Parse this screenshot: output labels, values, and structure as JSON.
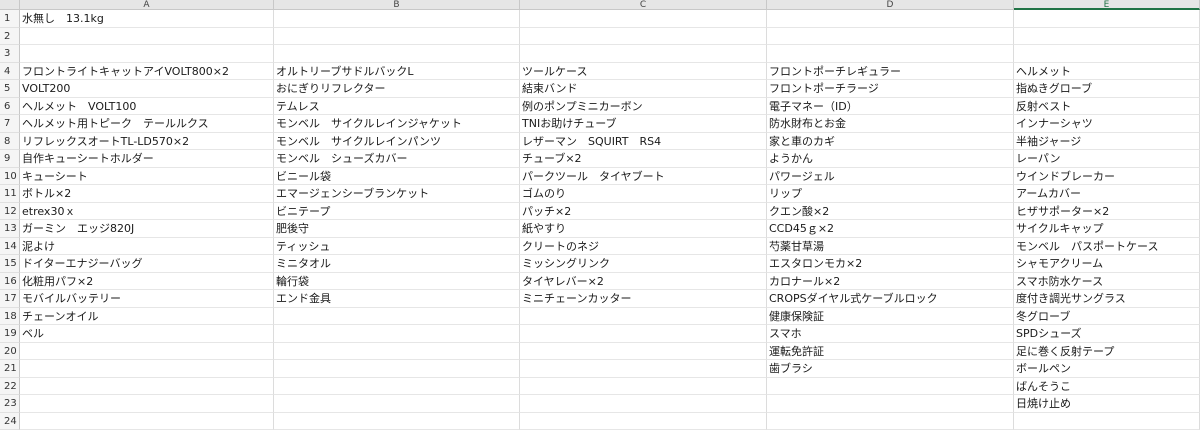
{
  "columns": [
    "A",
    "B",
    "C",
    "D",
    "E"
  ],
  "selected_column": "E",
  "rows": [
    {
      "num": "1",
      "cells": [
        "水無し　13.1kg",
        "",
        "",
        "",
        ""
      ]
    },
    {
      "num": "2",
      "cells": [
        "",
        "",
        "",
        "",
        ""
      ]
    },
    {
      "num": "3",
      "cells": [
        "",
        "",
        "",
        "",
        ""
      ]
    },
    {
      "num": "4",
      "cells": [
        "フロントライトキャットアイVOLT800×2",
        "オルトリーブサドルバックL",
        "ツールケース",
        "フロントポーチレギュラー",
        "ヘルメット"
      ]
    },
    {
      "num": "5",
      "cells": [
        "VOLT200",
        "おにぎりリフレクター",
        "結束バンド",
        "フロントポーチラージ",
        "指ぬきグローブ"
      ]
    },
    {
      "num": "6",
      "cells": [
        "ヘルメット　VOLT100",
        "テムレス",
        "例のポンプミニカーボン",
        "電子マネー（ID）",
        "反射ベスト"
      ]
    },
    {
      "num": "7",
      "cells": [
        "ヘルメット用トピーク　テールルクス",
        "モンベル　サイクルレインジャケット",
        "TNIお助けチューブ",
        "防水財布とお金",
        "インナーシャツ"
      ]
    },
    {
      "num": "8",
      "cells": [
        "リフレックスオートTL-LD570×2",
        "モンベル　サイクルレインパンツ",
        "レザーマン　SQUIRT　RS4",
        "家と車のカギ",
        "半袖ジャージ"
      ]
    },
    {
      "num": "9",
      "cells": [
        "自作キューシートホルダー",
        "モンベル　シューズカバー",
        "チューブ×2",
        "ようかん",
        "レーパン"
      ]
    },
    {
      "num": "10",
      "cells": [
        "キューシート",
        "ビニール袋",
        "パークツール　タイヤブート",
        "パワージェル",
        "ウインドブレーカー"
      ]
    },
    {
      "num": "11",
      "cells": [
        "ボトル×2",
        "エマージェンシーブランケット",
        "ゴムのり",
        "リップ",
        "アームカバー"
      ]
    },
    {
      "num": "12",
      "cells": [
        "etrex30ｘ",
        "ビニテープ",
        "パッチ×2",
        "クエン酸×2",
        "ヒザサポーター×2"
      ]
    },
    {
      "num": "13",
      "cells": [
        "ガーミン　エッジ820J",
        "肥後守",
        "紙やすり",
        "CCD45ｇ×2",
        "サイクルキャップ"
      ]
    },
    {
      "num": "14",
      "cells": [
        "泥よけ",
        "ティッシュ",
        "クリートのネジ",
        "芍薬甘草湯",
        "モンベル　パスポートケース"
      ]
    },
    {
      "num": "15",
      "cells": [
        "ドイターエナジーバッグ",
        "ミニタオル",
        "ミッシングリンク",
        "エスタロンモカ×2",
        "シャモアクリーム"
      ]
    },
    {
      "num": "16",
      "cells": [
        "化粧用パフ×2",
        "輪行袋",
        "タイヤレバー×2",
        "カロナール×2",
        "スマホ防水ケース"
      ]
    },
    {
      "num": "17",
      "cells": [
        "モバイルバッテリー",
        "エンド金具",
        "ミニチェーンカッター",
        "CROPSダイヤル式ケーブルロック",
        "度付き調光サングラス"
      ]
    },
    {
      "num": "18",
      "cells": [
        "チェーンオイル",
        "",
        "",
        "健康保険証",
        "冬グローブ"
      ]
    },
    {
      "num": "19",
      "cells": [
        "ベル",
        "",
        "",
        "スマホ",
        "SPDシューズ"
      ]
    },
    {
      "num": "20",
      "cells": [
        "",
        "",
        "",
        "運転免許証",
        "足に巻く反射テープ"
      ]
    },
    {
      "num": "21",
      "cells": [
        "",
        "",
        "",
        "歯ブラシ",
        "ボールペン"
      ]
    },
    {
      "num": "22",
      "cells": [
        "",
        "",
        "",
        "",
        "ばんそうこ"
      ]
    },
    {
      "num": "23",
      "cells": [
        "",
        "",
        "",
        "",
        "日焼け止め"
      ]
    },
    {
      "num": "24",
      "cells": [
        "",
        "",
        "",
        "",
        ""
      ]
    }
  ]
}
